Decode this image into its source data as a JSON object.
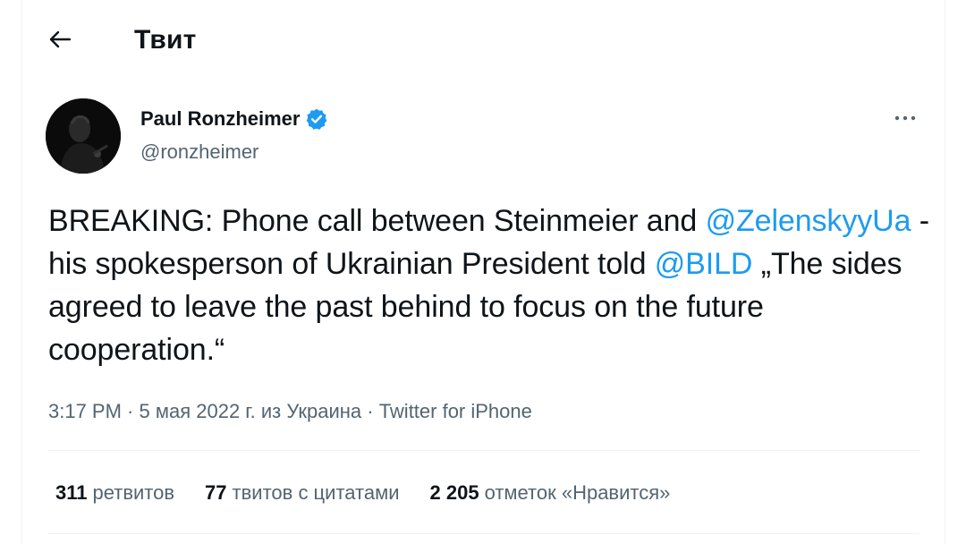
{
  "header": {
    "title": "Твит",
    "back_icon": "arrow-left-icon"
  },
  "tweet": {
    "author": {
      "name": "Paul Ronzheimer",
      "handle": "@ronzheimer",
      "verified_icon": "verified-badge-icon",
      "verified_color": "#1d9bf0"
    },
    "more_icon": "more-horizontal-icon",
    "text": {
      "part1": "BREAKING: Phone call between Steinmeier and ",
      "mention1": "@ZelenskyyUa",
      "part2": " - his spokesperson of Ukrainian President told ",
      "mention2": "@BILD",
      "part3": " „The sides agreed to leave the past behind to focus on the future cooperation.“"
    },
    "meta": {
      "time": "3:17 PM",
      "date": "5 мая 2022 г.",
      "location": "из Украина",
      "source": "Twitter for iPhone",
      "separator": " · "
    },
    "stats": [
      {
        "count": "311",
        "label": "ретвитов"
      },
      {
        "count": "77",
        "label": "твитов с цитатами"
      },
      {
        "count": "2 205",
        "label": "отметок «Нравится»"
      }
    ]
  },
  "colors": {
    "link": "#1d9bf0",
    "text": "#0f1419",
    "secondary": "#536471",
    "border": "#eff3f4"
  }
}
